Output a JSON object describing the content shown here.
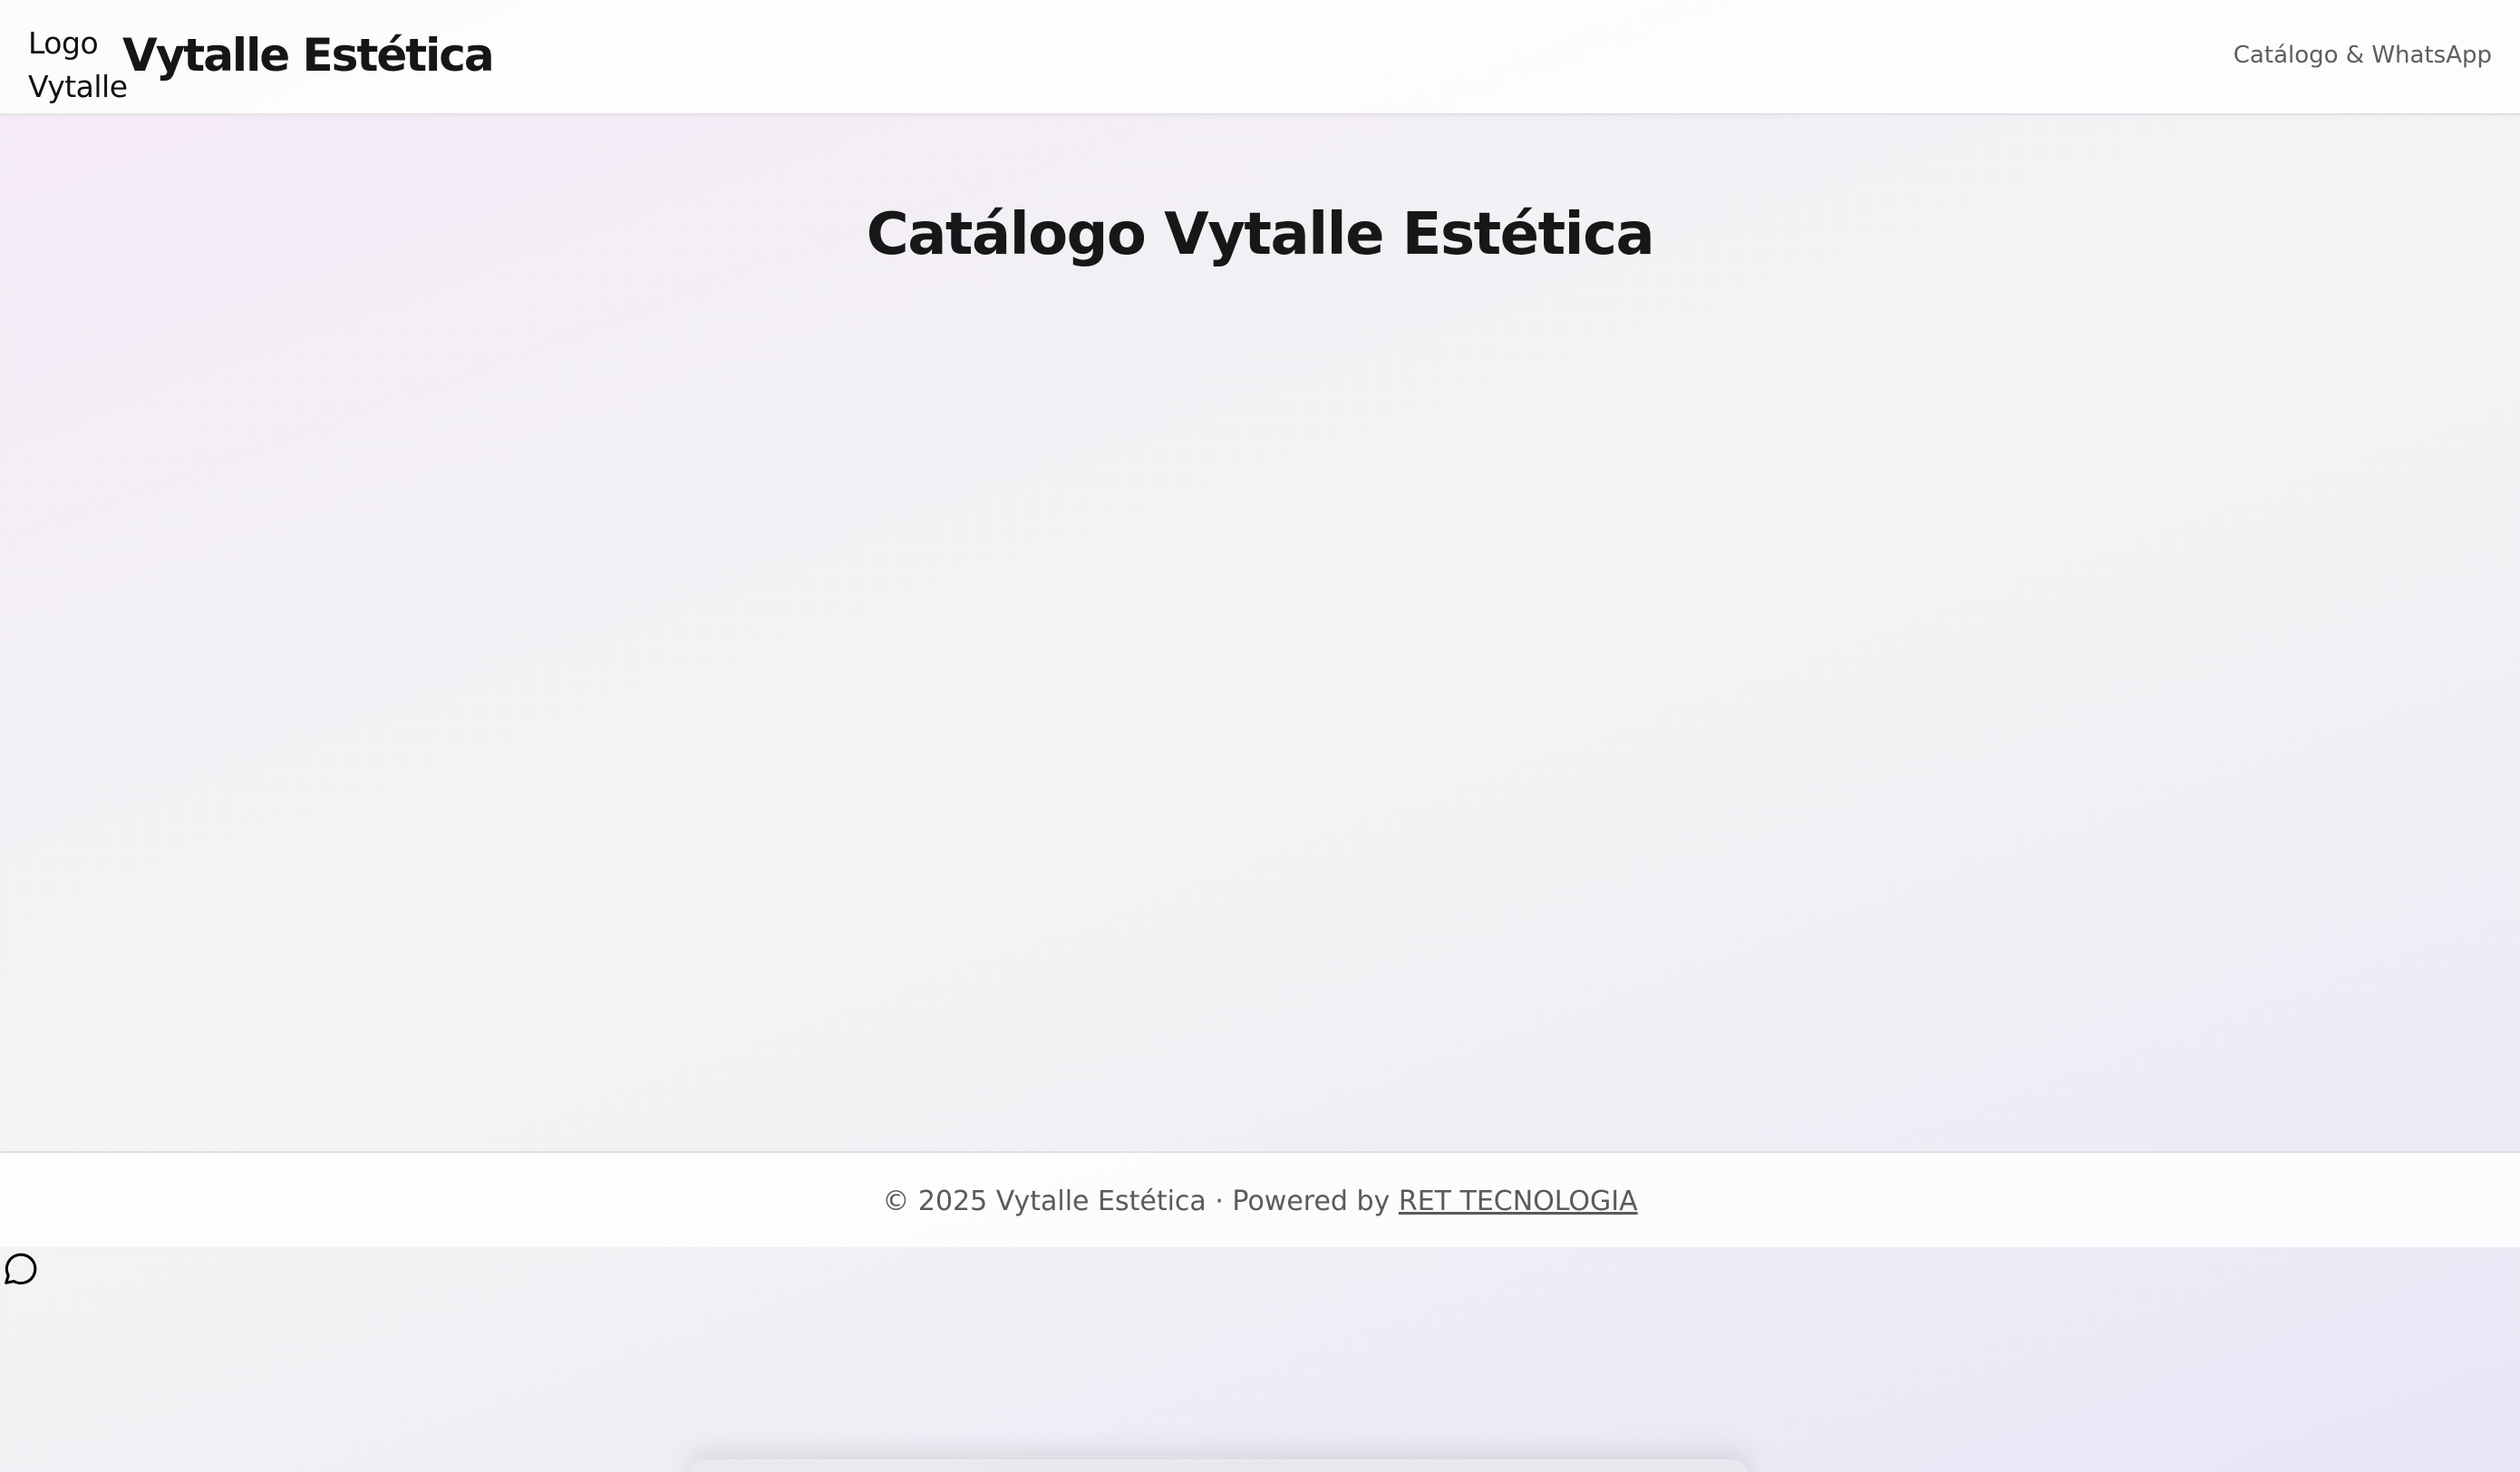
{
  "header": {
    "logo_alt_line1": "Logo",
    "logo_alt_line2": "Vytalle",
    "brand_name": "Vytalle Estética",
    "nav_link": "Catálogo & WhatsApp"
  },
  "main": {
    "title": "Catálogo Vytalle Estética"
  },
  "footer": {
    "copyright": "© 2025 Vytalle Estética · Powered by",
    "powered_link": "RET TECNOLOGIA"
  },
  "floating": {
    "chat_icon": "message-circle-icon"
  },
  "colors": {
    "gradient_start": "#f5e8f9",
    "gradient_end": "#e8e6f7",
    "text_dark": "#161616",
    "text_muted": "#5a5a5a"
  }
}
